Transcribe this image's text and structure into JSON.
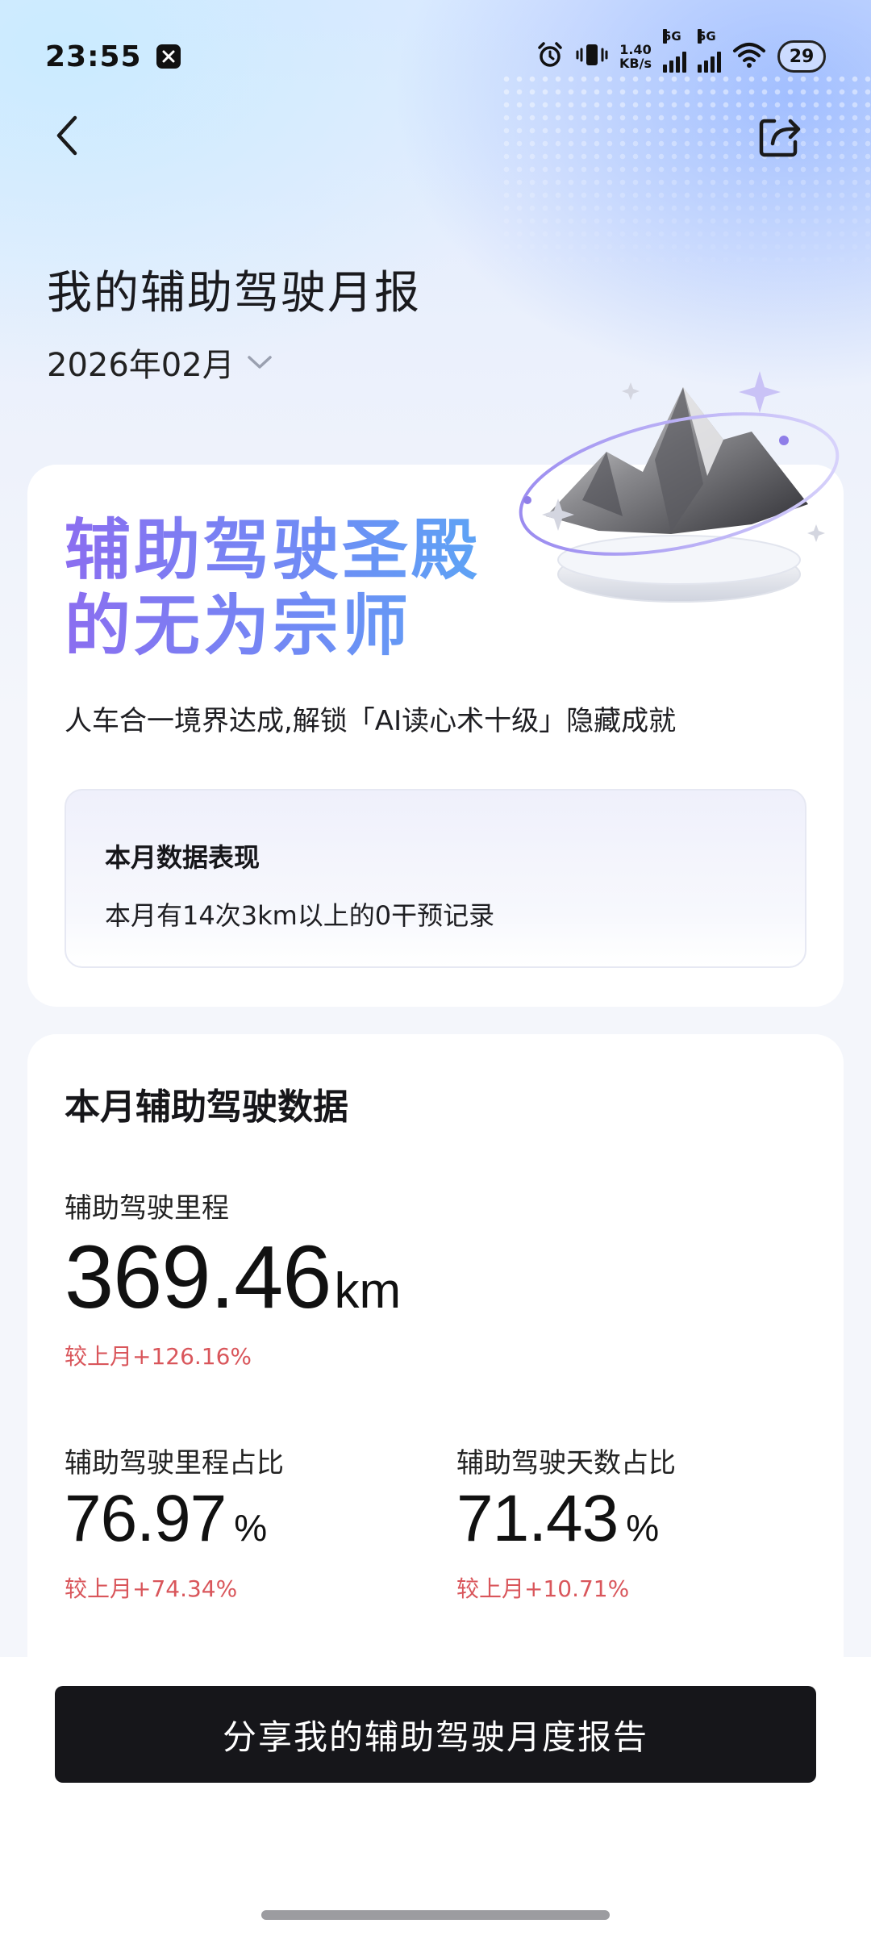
{
  "status_bar": {
    "time": "23:55",
    "net_speed_value": "1.40",
    "net_speed_unit": "KB/s",
    "sim1_label": "5G",
    "sim2_label": "5G",
    "battery": "29"
  },
  "header": {
    "title": "我的辅助驾驶月报",
    "month": "2026年02月"
  },
  "honor_card": {
    "title_line1": "辅助驾驶圣殿",
    "title_line2": "的无为宗师",
    "subtitle": "人车合一境界达成,解锁「AI读心术十级」隐藏成就",
    "performance": {
      "title": "本月数据表现",
      "text": "本月有14次3km以上的0干预记录"
    }
  },
  "stats_card": {
    "title": "本月辅助驾驶数据",
    "mileage": {
      "label": "辅助驾驶里程",
      "value": "369.46",
      "unit": "km",
      "delta": "较上月+126.16%"
    },
    "mileage_ratio": {
      "label": "辅助驾驶里程占比",
      "value": "76.97",
      "unit": "%",
      "delta": "较上月+74.34%"
    },
    "days_ratio": {
      "label": "辅助驾驶天数占比",
      "value": "71.43",
      "unit": "%",
      "delta": "较上月+10.71%"
    }
  },
  "share_button": {
    "label": "分享我的辅助驾驶月度报告"
  },
  "colors": {
    "accent_gradient_start": "#8b6ef0",
    "accent_gradient_end": "#5aa8f5",
    "delta_red": "#d9565b",
    "button_dark": "#16161a"
  }
}
